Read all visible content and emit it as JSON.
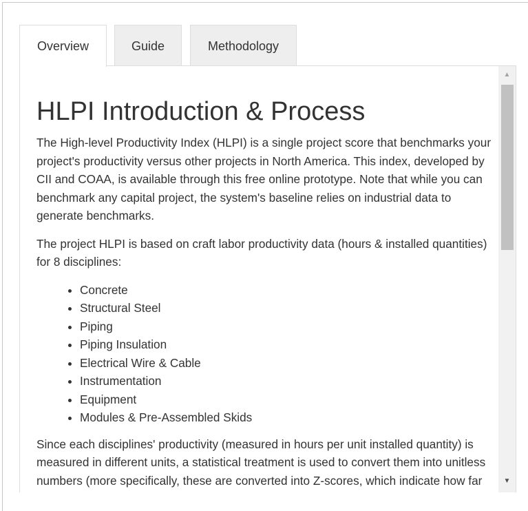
{
  "tabs": [
    {
      "label": "Overview",
      "active": true
    },
    {
      "label": "Guide",
      "active": false
    },
    {
      "label": "Methodology",
      "active": false
    }
  ],
  "content": {
    "title": "HLPI Introduction & Process",
    "paragraph1": "The High-level Productivity Index (HLPI) is a single project score that benchmarks your project's productivity versus other projects in North America. This index, developed by CII and COAA, is available through this free online prototype. Note that while you can benchmark any capital project, the system's baseline relies on industrial data to generate benchmarks.",
    "paragraph2": "The project HLPI is based on craft labor productivity data (hours & installed quantities) for 8 disciplines:",
    "disciplines": [
      "Concrete",
      "Structural Steel",
      "Piping",
      "Piping Insulation",
      "Electrical Wire & Cable",
      "Instrumentation",
      "Equipment",
      "Modules & Pre-Assembled Skids"
    ],
    "paragraph3": "Since each disciplines' productivity (measured in hours per unit installed quantity) is measured in different units, a statistical treatment is used to convert them into unitless numbers (more specifically, these are converted into Z-scores, which indicate how far one discipline score is from the average)."
  },
  "scrollbar": {
    "up_icon": "triangle-up",
    "down_icon": "triangle-down",
    "position": 0
  }
}
